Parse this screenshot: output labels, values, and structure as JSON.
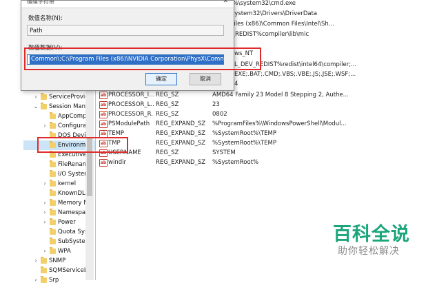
{
  "dialog": {
    "title": "编辑字符串",
    "close_glyph": "✕",
    "value_name_label": "数值名称(N):",
    "value_name": "Path",
    "value_data_label": "数值数据(V):",
    "value_data": "Common\\;C:\\Program Files (x86)\\NVIDIA Corporation\\PhysX\\Common",
    "ok_label": "确定",
    "cancel_label": "取消"
  },
  "top_data": [
    "mRoot%\\system32\\cmd.exe",
    "dows\\System32\\Drivers\\DriverData",
    "gram Files (x86)\\Common Files\\Intel\\Sh...",
    "L_DEV_REDIST%compiler\\lib\\mic",
    "ws_NT",
    "L_DEV_REDIST%redist\\intel64\\compiler;...",
    "EXE;.BAT;.CMD;.VBS;.VBE;.JS;.JSE;.WSF;...",
    "4"
  ],
  "registry_rows": [
    {
      "name": "PROCESSOR_I...",
      "type": "REG_SZ",
      "data": "AMD64 Family 23 Model 8 Stepping 2, Authe..."
    },
    {
      "name": "PROCESSOR_L...",
      "type": "REG_SZ",
      "data": "23"
    },
    {
      "name": "PROCESSOR_R...",
      "type": "REG_SZ",
      "data": "0802"
    },
    {
      "name": "PSModulePath",
      "type": "REG_EXPAND_SZ",
      "data": "%ProgramFiles%\\WindowsPowerShell\\Modul..."
    },
    {
      "name": "TEMP",
      "type": "REG_EXPAND_SZ",
      "data": "%SystemRoot%\\TEMP"
    },
    {
      "name": "TMP",
      "type": "REG_EXPAND_SZ",
      "data": "%SystemRoot%\\TEMP"
    },
    {
      "name": "USERNAME",
      "type": "REG_SZ",
      "data": "SYSTEM"
    },
    {
      "name": "windir",
      "type": "REG_EXPAND_SZ",
      "data": "%SystemRoot%"
    }
  ],
  "tree_items": [
    {
      "label": "ServiceProvic",
      "expander": "›"
    },
    {
      "label": "Session Man",
      "expander": "⌄"
    },
    {
      "label": "AppComp",
      "expander": ""
    },
    {
      "label": "Configurat",
      "expander": "›"
    },
    {
      "label": "DOS Devic",
      "expander": ""
    },
    {
      "label": "Environme",
      "expander": ""
    },
    {
      "label": "Executive",
      "expander": ""
    },
    {
      "label": "FileRenam",
      "expander": ""
    },
    {
      "label": "I/O Systen",
      "expander": ""
    },
    {
      "label": "kernel",
      "expander": "›"
    },
    {
      "label": "KnownDLL",
      "expander": ""
    },
    {
      "label": "Memory N",
      "expander": "›"
    },
    {
      "label": "Namespac",
      "expander": "›"
    },
    {
      "label": "Power",
      "expander": "›"
    },
    {
      "label": "Quota Sys",
      "expander": ""
    },
    {
      "label": "SubSysten",
      "expander": ""
    },
    {
      "label": "WPA",
      "expander": "›"
    },
    {
      "label": "SNMP",
      "expander": "›"
    },
    {
      "label": "SQMServiceL",
      "expander": ""
    },
    {
      "label": "Srp",
      "expander": "›"
    }
  ],
  "watermark": {
    "title": "百科全说",
    "subtitle": "助你轻松解决"
  },
  "colors": {
    "highlight_red": "#e02a2a",
    "selection_blue": "#2f6fc6",
    "folder_yellow": "#f3cf6a",
    "watermark_green": "#1aa67a"
  }
}
